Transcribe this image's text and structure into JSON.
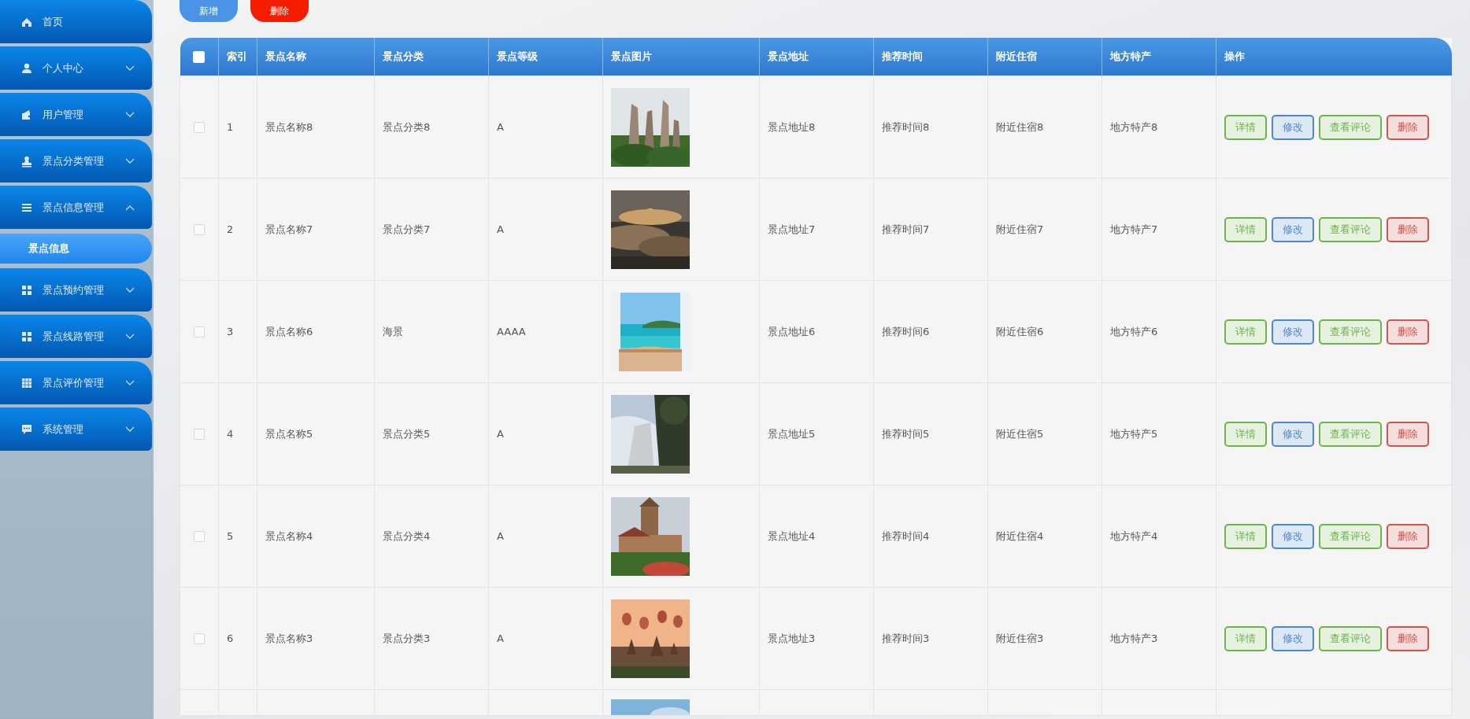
{
  "sidebar": {
    "items": [
      {
        "label": "首页"
      },
      {
        "label": "个人中心",
        "expanded": false
      },
      {
        "label": "用户管理",
        "expanded": false
      },
      {
        "label": "景点分类管理",
        "expanded": false
      },
      {
        "label": "景点信息管理",
        "expanded": true,
        "children": [
          {
            "label": "景点信息",
            "selected": true
          }
        ]
      },
      {
        "label": "景点预约管理",
        "expanded": false
      },
      {
        "label": "景点线路管理",
        "expanded": false
      },
      {
        "label": "景点评价管理",
        "expanded": false
      },
      {
        "label": "系统管理",
        "expanded": false
      }
    ]
  },
  "toolbar": {
    "buttons": [
      {
        "label": "新增",
        "kind": "add"
      },
      {
        "label": "删除",
        "kind": "delete"
      }
    ]
  },
  "table": {
    "select_all": {
      "checked": false
    },
    "columns": [
      "索引",
      "景点名称",
      "景点分类",
      "景点等级",
      "景点图片",
      "景点地址",
      "推荐时间",
      "附近住宿",
      "地方特产",
      "操作"
    ],
    "rows": [
      {
        "checked": false,
        "cells": [
          "1",
          "景点名称8",
          "景点分类8",
          "A",
          {
            "kind": "picture"
          },
          "景点地址8",
          "推荐时间8",
          "附近住宿8",
          "地方特产8"
        ],
        "actions": [
          {
            "label": "详情",
            "kind": "detail"
          },
          {
            "label": "修改",
            "kind": "edit"
          },
          {
            "label": "查看评论",
            "kind": "comments"
          },
          {
            "label": "删除",
            "kind": "delete"
          }
        ]
      },
      {
        "checked": false,
        "cells": [
          "2",
          "景点名称7",
          "景点分类7",
          "A",
          {
            "kind": "picture"
          },
          "景点地址7",
          "推荐时间7",
          "附近住宿7",
          "地方特产7"
        ],
        "actions": [
          {
            "label": "详情",
            "kind": "detail"
          },
          {
            "label": "修改",
            "kind": "edit"
          },
          {
            "label": "查看评论",
            "kind": "comments"
          },
          {
            "label": "删除",
            "kind": "delete"
          }
        ]
      },
      {
        "checked": false,
        "cells": [
          "3",
          "景点名称6",
          "海景",
          "AAAA",
          {
            "kind": "picture"
          },
          "景点地址6",
          "推荐时间6",
          "附近住宿6",
          "地方特产6"
        ],
        "actions": [
          {
            "label": "详情",
            "kind": "detail"
          },
          {
            "label": "修改",
            "kind": "edit"
          },
          {
            "label": "查看评论",
            "kind": "comments"
          },
          {
            "label": "删除",
            "kind": "delete"
          }
        ]
      },
      {
        "checked": false,
        "cells": [
          "4",
          "景点名称5",
          "景点分类5",
          "A",
          {
            "kind": "picture"
          },
          "景点地址5",
          "推荐时间5",
          "附近住宿5",
          "地方特产5"
        ],
        "actions": [
          {
            "label": "详情",
            "kind": "detail"
          },
          {
            "label": "修改",
            "kind": "edit"
          },
          {
            "label": "查看评论",
            "kind": "comments"
          },
          {
            "label": "删除",
            "kind": "delete"
          }
        ]
      },
      {
        "checked": false,
        "cells": [
          "5",
          "景点名称4",
          "景点分类4",
          "A",
          {
            "kind": "picture"
          },
          "景点地址4",
          "推荐时间4",
          "附近住宿4",
          "地方特产4"
        ],
        "actions": [
          {
            "label": "详情",
            "kind": "detail"
          },
          {
            "label": "修改",
            "kind": "edit"
          },
          {
            "label": "查看评论",
            "kind": "comments"
          },
          {
            "label": "删除",
            "kind": "delete"
          }
        ]
      },
      {
        "checked": false,
        "cells": [
          "6",
          "景点名称3",
          "景点分类3",
          "A",
          {
            "kind": "picture"
          },
          "景点地址3",
          "推荐时间3",
          "附近住宿3",
          "地方特产3"
        ],
        "actions": [
          {
            "label": "详情",
            "kind": "detail"
          },
          {
            "label": "修改",
            "kind": "edit"
          },
          {
            "label": "查看评论",
            "kind": "comments"
          },
          {
            "label": "删除",
            "kind": "delete"
          }
        ]
      },
      {
        "kind": "partial",
        "picture": {
          "kind": "picture"
        }
      }
    ]
  }
}
